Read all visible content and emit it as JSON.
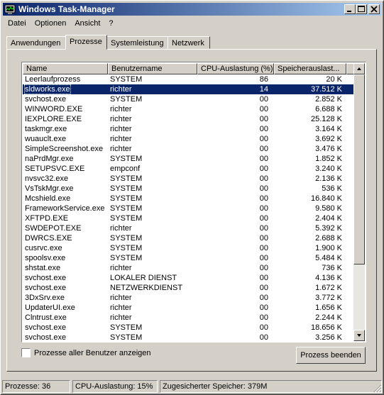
{
  "window": {
    "title": "Windows Task-Manager",
    "app_icon": "task-manager-icon"
  },
  "caption_buttons": {
    "minimize": "minimize-icon",
    "maximize": "maximize-icon",
    "close": "close-icon"
  },
  "menu": [
    "Datei",
    "Optionen",
    "Ansicht",
    "?"
  ],
  "tabs": [
    {
      "label": "Anwendungen"
    },
    {
      "label": "Prozesse",
      "active": true
    },
    {
      "label": "Systemleistung"
    },
    {
      "label": "Netzwerk"
    }
  ],
  "table": {
    "columns": [
      "Name",
      "Benutzername",
      "CPU-Auslastung (%)",
      "Speicherauslast..."
    ],
    "selected_index": 1,
    "rows": [
      [
        "Leerlaufprozess",
        "SYSTEM",
        "86",
        "20 K"
      ],
      [
        "sldworks.exe",
        "richter",
        "14",
        "37.512 K"
      ],
      [
        "svchost.exe",
        "SYSTEM",
        "00",
        "2.852 K"
      ],
      [
        "WINWORD.EXE",
        "richter",
        "00",
        "6.688 K"
      ],
      [
        "IEXPLORE.EXE",
        "richter",
        "00",
        "25.128 K"
      ],
      [
        "taskmgr.exe",
        "richter",
        "00",
        "3.164 K"
      ],
      [
        "wuauclt.exe",
        "richter",
        "00",
        "3.692 K"
      ],
      [
        "SimpleScreenshot.exe",
        "richter",
        "00",
        "3.476 K"
      ],
      [
        "naPrdMgr.exe",
        "SYSTEM",
        "00",
        "1.852 K"
      ],
      [
        "SETUPSVC.EXE",
        "empconf",
        "00",
        "3.240 K"
      ],
      [
        "nvsvc32.exe",
        "SYSTEM",
        "00",
        "2.136 K"
      ],
      [
        "VsTskMgr.exe",
        "SYSTEM",
        "00",
        "536 K"
      ],
      [
        "Mcshield.exe",
        "SYSTEM",
        "00",
        "16.840 K"
      ],
      [
        "FrameworkService.exe",
        "SYSTEM",
        "00",
        "9.580 K"
      ],
      [
        "XFTPD.EXE",
        "SYSTEM",
        "00",
        "2.404 K"
      ],
      [
        "SWDEPOT.EXE",
        "richter",
        "00",
        "5.392 K"
      ],
      [
        "DWRCS.EXE",
        "SYSTEM",
        "00",
        "2.688 K"
      ],
      [
        "cusrvc.exe",
        "SYSTEM",
        "00",
        "1.900 K"
      ],
      [
        "spoolsv.exe",
        "SYSTEM",
        "00",
        "5.484 K"
      ],
      [
        "shstat.exe",
        "richter",
        "00",
        "736 K"
      ],
      [
        "svchost.exe",
        "LOKALER DIENST",
        "00",
        "4.136 K"
      ],
      [
        "svchost.exe",
        "NETZWERKDIENST",
        "00",
        "1.672 K"
      ],
      [
        "3DxSrv.exe",
        "richter",
        "00",
        "3.772 K"
      ],
      [
        "UpdaterUI.exe",
        "richter",
        "00",
        "1.656 K"
      ],
      [
        "Clntrust.exe",
        "richter",
        "00",
        "2.244 K"
      ],
      [
        "svchost.exe",
        "SYSTEM",
        "00",
        "18.656 K"
      ],
      [
        "svchost.exe",
        "SYSTEM",
        "00",
        "3.256 K"
      ]
    ]
  },
  "checkbox": {
    "label": "Prozesse aller Benutzer anzeigen",
    "checked": false
  },
  "end_process_button": "Prozess beenden",
  "status": {
    "processes": "Prozesse: 36",
    "cpu": "CPU-Auslastung: 15%",
    "memory": "Zugesicherter Speicher: 379M"
  },
  "colors": {
    "titlebar_start": "#0a246a",
    "titlebar_end": "#a6caf0",
    "selection": "#0a246a",
    "face": "#d4d0c8"
  }
}
